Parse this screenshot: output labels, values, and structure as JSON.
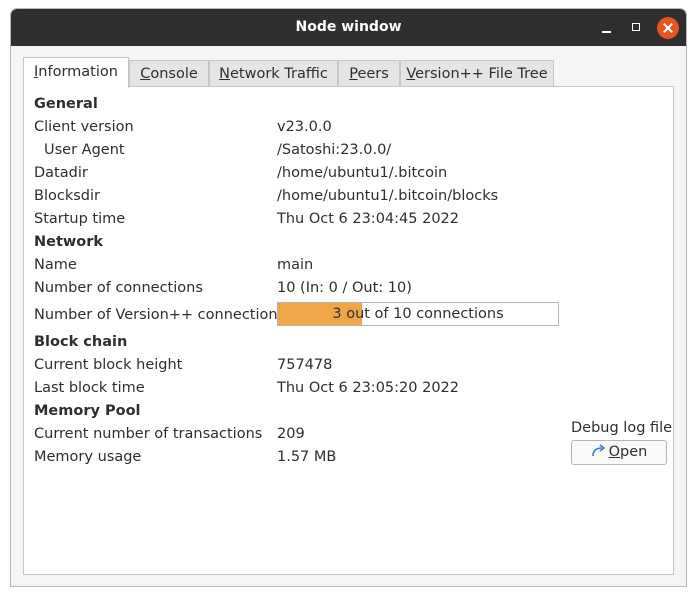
{
  "window": {
    "title": "Node window"
  },
  "tabs": [
    {
      "prefix": "",
      "key": "I",
      "rest": "nformation"
    },
    {
      "prefix": "",
      "key": "C",
      "rest": "onsole"
    },
    {
      "prefix": "",
      "key": "N",
      "rest": "etwork Traffic"
    },
    {
      "prefix": "",
      "key": "P",
      "rest": "eers"
    },
    {
      "prefix": "",
      "key": "V",
      "rest": "ersion++ File Tree"
    }
  ],
  "info": {
    "general": {
      "heading": "General",
      "client_version_label": "Client version",
      "client_version": "v23.0.0",
      "user_agent_label": "User Agent",
      "user_agent": "/Satoshi:23.0.0/",
      "datadir_label": "Datadir",
      "datadir": "/home/ubuntu1/.bitcoin",
      "blocksdir_label": "Blocksdir",
      "blocksdir": "/home/ubuntu1/.bitcoin/blocks",
      "startup_time_label": "Startup time",
      "startup_time": "Thu Oct 6 23:04:45 2022"
    },
    "network": {
      "heading": "Network",
      "name_label": "Name",
      "name": "main",
      "connections_label": "Number of connections",
      "connections": "10 (In: 0 / Out: 10)",
      "vpp_connections_label": "Number of Version++ connections",
      "vpp_progress_text": "3 out of 10 connections",
      "vpp_progress_fraction": 0.3,
      "vpp_progress_color": "#f0a546"
    },
    "blockchain": {
      "heading": "Block chain",
      "height_label": "Current block height",
      "height": "757478",
      "last_block_time_label": "Last block time",
      "last_block_time": "Thu Oct 6 23:05:20 2022"
    },
    "mempool": {
      "heading": "Memory Pool",
      "tx_count_label": "Current number of transactions",
      "tx_count": "209",
      "usage_label": "Memory usage",
      "usage": "1.57 MB"
    }
  },
  "debug": {
    "label": "Debug log file",
    "open_key": "O",
    "open_rest": "pen",
    "open_icon": "open-arrow-icon"
  }
}
